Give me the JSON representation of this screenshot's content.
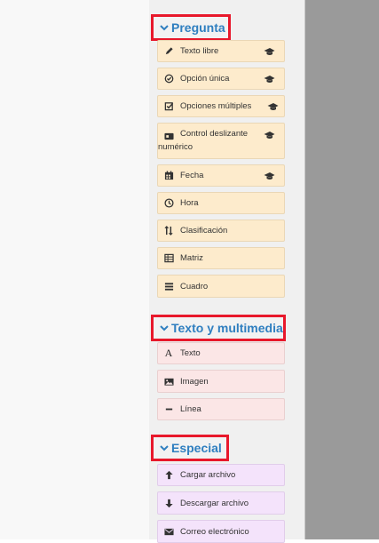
{
  "sections": {
    "pregunta": {
      "title": "Pregunta",
      "items": [
        {
          "label": "Texto libre",
          "icon": "pencil-icon",
          "badge": "graduation-cap-icon"
        },
        {
          "label": "Opción única",
          "icon": "check-circle-icon",
          "badge": "graduation-cap-icon"
        },
        {
          "label": "Opciones múltiples",
          "icon": "check-square-icon",
          "badge": "graduation-cap-icon"
        },
        {
          "label_line1": "Control deslizante",
          "label_line2": "numérico",
          "icon": "slider-icon",
          "badge": "graduation-cap-icon"
        },
        {
          "label": "Fecha",
          "icon": "calendar-icon",
          "badge": "graduation-cap-icon"
        },
        {
          "label": "Hora",
          "icon": "clock-icon"
        },
        {
          "label": "Clasificación",
          "icon": "sort-icon"
        },
        {
          "label": "Matriz",
          "icon": "matrix-icon"
        },
        {
          "label": "Cuadro",
          "icon": "list-icon"
        }
      ]
    },
    "texto": {
      "title": "Texto y multimedia",
      "items": [
        {
          "label": "Texto",
          "icon": "A"
        },
        {
          "label": "Imagen",
          "icon": "image-icon"
        },
        {
          "label": "Línea",
          "icon": "line-icon"
        }
      ]
    },
    "especial": {
      "title": "Especial",
      "items": [
        {
          "label": "Cargar archivo",
          "icon": "upload-arrow-icon"
        },
        {
          "label": "Descargar archivo",
          "icon": "download-arrow-icon"
        },
        {
          "label": "Correo electrónico",
          "icon": "envelope-icon"
        }
      ]
    }
  },
  "colors": {
    "header_text": "#2f7fc0",
    "highlight_border": "#e8182b",
    "pregunta_item_bg": "#fdebcc",
    "texto_item_bg": "#fbe6e6",
    "especial_item_bg": "#f4e3fb"
  }
}
